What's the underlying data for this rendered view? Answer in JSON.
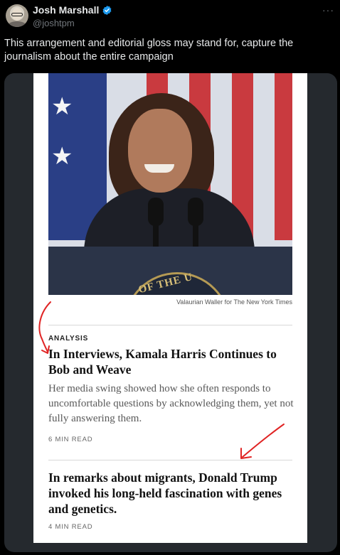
{
  "tweet": {
    "display_name": "Josh Marshall",
    "handle": "@joshtpm",
    "text": "This arrangement and editorial gloss may stand for, capture the journalism about the entire campaign",
    "more_icon": "···",
    "verified_color": "#1d9bf0"
  },
  "article": {
    "photo_credit": "Valaurian Waller for The New York Times",
    "seal_text": "OF THE U",
    "kicker": "ANALYSIS",
    "headline_1": "In Interviews, Kamala Harris Continues to Bob and Weave",
    "summary": "Her media swing showed how she often responds to uncomfortable questions by acknowledging them, yet not fully answering them.",
    "read_time_1": "6 MIN READ",
    "headline_2": "In remarks about migrants, Donald Trump invoked his long-held fascination with genes and genetics.",
    "read_time_2": "4 MIN READ"
  },
  "colors": {
    "background": "#000000",
    "media_background": "#25292e",
    "annotation_red": "#e02424"
  }
}
